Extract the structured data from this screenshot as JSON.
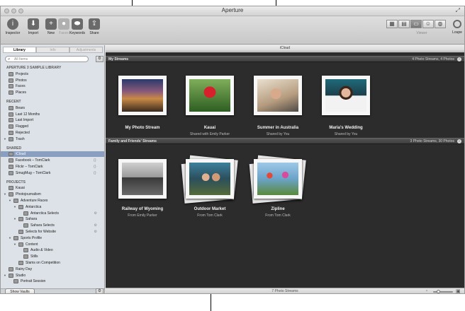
{
  "window": {
    "title": "Aperture"
  },
  "toolbar": {
    "left_buttons": [
      {
        "label": "Inspector",
        "glyph": "i",
        "name": "inspector-button"
      },
      {
        "label": "Import",
        "glyph": "⬇",
        "name": "import-button"
      },
      {
        "label": "New",
        "glyph": "+",
        "name": "new-button"
      },
      {
        "label": "Faces",
        "glyph": "●",
        "name": "faces-button",
        "dim": true
      },
      {
        "label": "Keywords",
        "glyph": "⬬",
        "name": "keywords-button"
      },
      {
        "label": "Share",
        "glyph": "⇪",
        "name": "share-button"
      }
    ],
    "viewer_label": "Viewer",
    "loupe_label": "Loupe"
  },
  "sidebar": {
    "tabs": [
      "Library",
      "Info",
      "Adjustments"
    ],
    "search_placeholder": "All Items",
    "show_vaults_label": "Show Vaults"
  },
  "library": [
    {
      "type": "head",
      "label": "APERTURE 3 SAMPLE LIBRARY"
    },
    {
      "label": "Projects",
      "indent": 0
    },
    {
      "label": "Photos",
      "indent": 0
    },
    {
      "label": "Faces",
      "indent": 0
    },
    {
      "label": "Places",
      "indent": 0
    },
    {
      "type": "head",
      "label": "RECENT"
    },
    {
      "label": "Bears",
      "indent": 0
    },
    {
      "label": "Last 12 Months",
      "indent": 0
    },
    {
      "label": "Last Import",
      "indent": 0
    },
    {
      "label": "Flagged",
      "indent": 0
    },
    {
      "label": "Rejected",
      "indent": 0
    },
    {
      "label": "Trash",
      "indent": 0,
      "tri": true
    },
    {
      "type": "head",
      "label": "SHARED"
    },
    {
      "label": "iCloud",
      "indent": 0,
      "selected": true
    },
    {
      "label": "Facebook – TomClark",
      "indent": 0,
      "end": "((·"
    },
    {
      "label": "Flickr – TomClark",
      "indent": 0,
      "end": "((·"
    },
    {
      "label": "SmugMug – TomClark",
      "indent": 0,
      "end": "((·"
    },
    {
      "type": "head",
      "label": "PROJECTS"
    },
    {
      "label": "Kauai",
      "indent": 0
    },
    {
      "label": "Photojournalism",
      "indent": 0,
      "tri": true
    },
    {
      "label": "Adventure Races",
      "indent": 1,
      "tri": true
    },
    {
      "label": "Antarctica",
      "indent": 2,
      "tri": true
    },
    {
      "label": "Antarctica Selects",
      "indent": 3,
      "end": "⚙"
    },
    {
      "label": "Sahara",
      "indent": 2,
      "tri": true
    },
    {
      "label": "Sahara Selects",
      "indent": 3,
      "end": "⚙"
    },
    {
      "label": "Selects for Website",
      "indent": 2,
      "end": "⚙"
    },
    {
      "label": "Sports Profile",
      "indent": 1,
      "tri": true
    },
    {
      "label": "Content",
      "indent": 2,
      "tri": true
    },
    {
      "label": "Audio & Video",
      "indent": 3
    },
    {
      "label": "Stills",
      "indent": 3
    },
    {
      "label": "Slams on Competition",
      "indent": 2
    },
    {
      "label": "Rainy Day",
      "indent": 0
    },
    {
      "label": "Studio",
      "indent": 0,
      "tri": true
    },
    {
      "label": "Portrait Session",
      "indent": 1
    }
  ],
  "main": {
    "header": "iCloud",
    "sections": [
      {
        "title": "My Streams",
        "count": "4 Photo Streams, 4 Photos",
        "streams": [
          {
            "name": "My Photo Stream",
            "sub": "",
            "style": "single"
          },
          {
            "name": "Kauai",
            "sub": "Shared with Emily Parker",
            "style": "single"
          },
          {
            "name": "Summer in Australia",
            "sub": "Shared by You",
            "style": "single"
          },
          {
            "name": "Maria's Wedding",
            "sub": "Shared by You",
            "style": "single"
          }
        ]
      },
      {
        "title": "Family and Friends' Streams",
        "count": "3 Photo Streams, 30 Photos",
        "streams": [
          {
            "name": "Railway of Wyoming",
            "sub": "From Emily Parker",
            "style": "single"
          },
          {
            "name": "Outdoor Market",
            "sub": "From Tom Clark",
            "style": "stack"
          },
          {
            "name": "Zipline",
            "sub": "From Tom Clark",
            "style": "stack"
          }
        ]
      }
    ],
    "status": "7 Photo Streams"
  }
}
